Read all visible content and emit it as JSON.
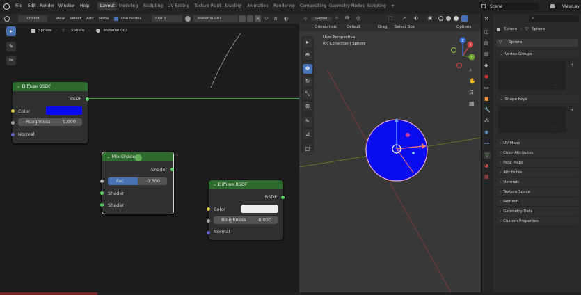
{
  "menu": [
    "File",
    "Edit",
    "Render",
    "Window",
    "Help"
  ],
  "workspaces": [
    "Layout",
    "Modeling",
    "Sculpting",
    "UV Editing",
    "Texture Paint",
    "Shading",
    "Animation",
    "Rendering",
    "Compositing",
    "Geometry Nodes",
    "Scripting"
  ],
  "workspace_add": "+",
  "scene": {
    "label": "Scene",
    "view_layer": "ViewLay"
  },
  "node_header": {
    "mode": "Object",
    "view": "View",
    "select": "Select",
    "add": "Add",
    "node": "Node",
    "use_nodes": "Use Nodes",
    "slot": "Slot 1",
    "material": "Material.001"
  },
  "breadcrumb": {
    "object": "Sphere",
    "mesh": "Sphere",
    "material": "Material.001"
  },
  "nodes": {
    "diffuse1": {
      "title": "Diffuse BSDF",
      "output": "BSDF",
      "color_label": "Color",
      "roughness_label": "Roughness",
      "roughness": "0.000",
      "normal_label": "Normal",
      "color": "#0a0af0"
    },
    "mix": {
      "title": "Mix Shader",
      "output": "Shader",
      "fac_label": "Fac",
      "fac": "0.500",
      "fac_fraction": 0.5,
      "in1": "Shader",
      "in2": "Shader"
    },
    "diffuse2": {
      "title": "Diffuse BSDF",
      "output": "BSDF",
      "color_label": "Color",
      "roughness_label": "Roughness",
      "roughness": "0.000",
      "normal_label": "Normal",
      "color": "#eeeeee"
    }
  },
  "viewport": {
    "global": "Global",
    "orientation_label": "Orientation:",
    "orientation": "Default",
    "drag_label": "Drag:",
    "drag": "Select Box",
    "options": "Options",
    "perspective": "User Perspective",
    "collection": "(0) Collection | Sphere",
    "gizmo_x": "X",
    "gizmo_y": "Y",
    "gizmo_z": "Z"
  },
  "properties": {
    "object": "Sphere",
    "mesh": "Sphere",
    "datablock": "Sphere",
    "panels": [
      "Vertex Groups",
      "Shape Keys"
    ],
    "collapsed": [
      "UV Maps",
      "Color Attributes",
      "Face Maps",
      "Attributes",
      "Normals",
      "Texture Space",
      "Remesh",
      "Geometry Data",
      "Custom Properties"
    ]
  },
  "colors": {
    "node_header": "#2d6a2d",
    "accent": "#4772b3",
    "sphere": "#0b0bf0",
    "active_tab": "#5680c2"
  }
}
